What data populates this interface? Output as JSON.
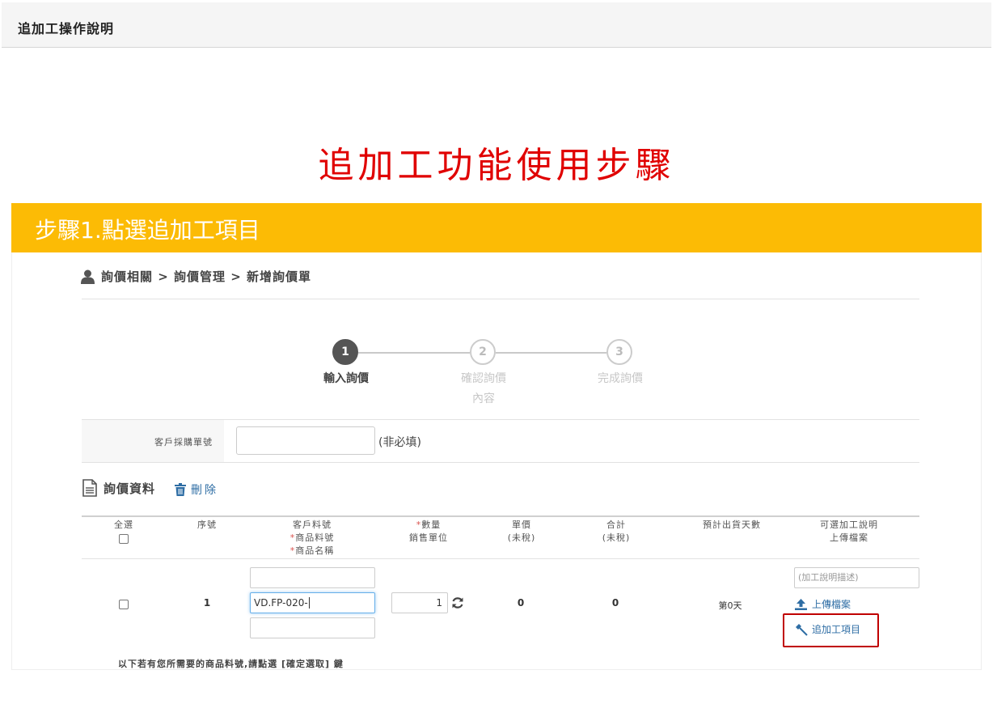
{
  "header": {
    "title": "追加工操作說明"
  },
  "main_title": "追加工功能使用步驟",
  "step_banner": {
    "text": "步驟1.點選追加工項目"
  },
  "breadcrumb": {
    "text": "詢價相關 > 詢價管理 > 新增詢價單"
  },
  "stepper": {
    "steps": [
      {
        "number": "1",
        "label": "輸入詢價",
        "state": "active"
      },
      {
        "number": "2",
        "label_line1": "確認詢價",
        "label_line2": "內容",
        "state": "inactive"
      },
      {
        "number": "3",
        "label": "完成詢價",
        "state": "inactive"
      }
    ]
  },
  "purchase_order": {
    "label": "客戶採購單號",
    "value": "",
    "hint": "(非必填)"
  },
  "inquiry_section": {
    "title": "詢價資料",
    "delete_label": "刪除"
  },
  "table": {
    "headers": {
      "select_all": "全選",
      "seq": "序號",
      "customer_part": "客戶料號",
      "product_part": "商品料號",
      "product_name": "商品名稱",
      "quantity": "數量",
      "sales_unit": "銷售單位",
      "unit_price": "單價",
      "unit_price_sub": "(未稅)",
      "total": "合計",
      "total_sub": "(未稅)",
      "ship_days": "預計出貨天數",
      "extra_desc": "可選加工說明",
      "upload": "上傳檔案"
    },
    "rows": [
      {
        "seq": "1",
        "customer_part": "",
        "product_part": "VD.FP-020-",
        "product_name": "",
        "quantity": "1",
        "unit_price": "0",
        "total": "0",
        "ship_days": "第0天",
        "desc_placeholder": "(加工說明描述)",
        "upload_label": "上傳檔案",
        "extra_label": "追加工項目"
      }
    ]
  },
  "note": "以下若有您所需要的商品料號,請點選 [確定選取] 鍵",
  "colors": {
    "banner": "#fcbb05",
    "title_red": "#e00000",
    "highlight": "#c00000",
    "link": "#2e6da4"
  },
  "icons": [
    "user-icon",
    "document-icon",
    "trash-icon",
    "refresh-icon",
    "upload-icon",
    "hammer-icon"
  ]
}
